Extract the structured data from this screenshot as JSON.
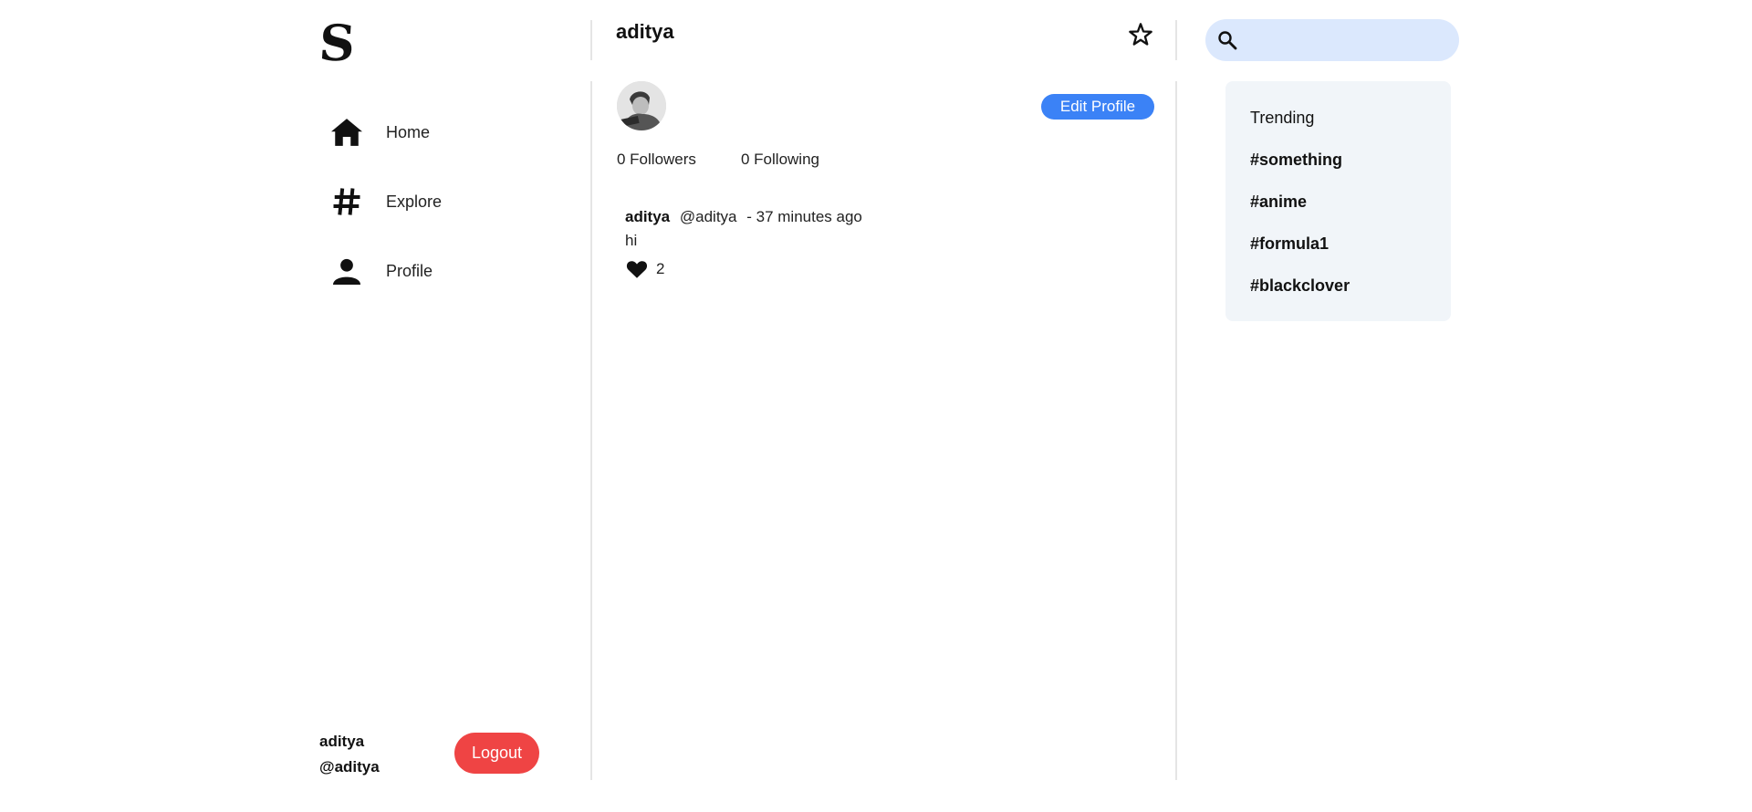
{
  "sidebar": {
    "logo": "S",
    "items": [
      {
        "label": "Home",
        "icon": "home-icon"
      },
      {
        "label": "Explore",
        "icon": "hashtag-icon"
      },
      {
        "label": "Profile",
        "icon": "person-icon"
      }
    ],
    "user": {
      "name": "aditya",
      "handle": "@aditya"
    },
    "logout_label": "Logout"
  },
  "profile": {
    "title": "aditya",
    "edit_label": "Edit Profile",
    "followers": "0 Followers",
    "following": "0 Following"
  },
  "posts": [
    {
      "author": "aditya",
      "handle": "@aditya",
      "time": "- 37 minutes ago",
      "text": "hi",
      "likes": "2"
    }
  ],
  "search": {
    "placeholder": ""
  },
  "trending": {
    "title": "Trending",
    "tags": [
      "#something",
      "#anime",
      "#formula1",
      "#blackclover"
    ]
  },
  "colors": {
    "accent": "#3b82f6",
    "logout": "#ef4444",
    "search_bg": "#dbe8fd",
    "panel_bg": "#f1f5f9"
  }
}
